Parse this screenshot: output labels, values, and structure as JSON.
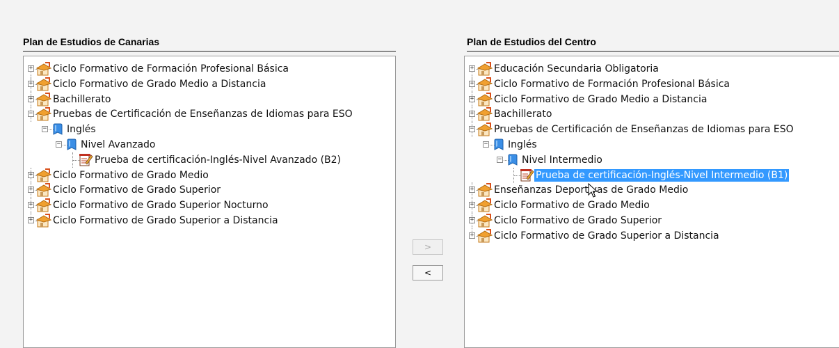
{
  "left_panel": {
    "title": "Plan de Estudios de Canarias",
    "nodes": [
      {
        "label": "Ciclo Formativo de Formación Profesional Básica",
        "expander": "+",
        "icon": "graduation-cap-icon"
      },
      {
        "label": "Ciclo Formativo de Grado Medio a Distancia",
        "expander": "+",
        "icon": "graduation-cap-icon"
      },
      {
        "label": "Bachillerato",
        "expander": "+",
        "icon": "graduation-cap-icon"
      },
      {
        "label": "Pruebas de Certificación de Enseñanzas de Idiomas para ESO",
        "expander": "−",
        "icon": "graduation-cap-icon"
      },
      {
        "label": "Inglés",
        "expander": "−",
        "icon": "bookmark-icon"
      },
      {
        "label": "Nivel Avanzado",
        "expander": "−",
        "icon": "bookmark-icon"
      },
      {
        "label": "Prueba de certificación-Inglés-Nivel Avanzado (B2)",
        "expander": "",
        "icon": "edit-document-icon"
      },
      {
        "label": "Ciclo Formativo de Grado Medio",
        "expander": "+",
        "icon": "graduation-cap-icon"
      },
      {
        "label": "Ciclo Formativo de Grado Superior",
        "expander": "+",
        "icon": "graduation-cap-icon"
      },
      {
        "label": "Ciclo Formativo de Grado Superior Nocturno",
        "expander": "+",
        "icon": "graduation-cap-icon"
      },
      {
        "label": "Ciclo Formativo de Grado Superior a Distancia",
        "expander": "+",
        "icon": "graduation-cap-icon"
      }
    ]
  },
  "right_panel": {
    "title": "Plan de Estudios del Centro",
    "nodes": [
      {
        "label": "Educación Secundaria Obligatoria",
        "expander": "+",
        "icon": "graduation-cap-icon"
      },
      {
        "label": "Ciclo Formativo de Formación Profesional Básica",
        "expander": "+",
        "icon": "graduation-cap-icon"
      },
      {
        "label": "Ciclo Formativo de Grado Medio a Distancia",
        "expander": "+",
        "icon": "graduation-cap-icon"
      },
      {
        "label": "Bachillerato",
        "expander": "+",
        "icon": "graduation-cap-icon"
      },
      {
        "label": "Pruebas de Certificación de Enseñanzas de Idiomas para ESO",
        "expander": "−",
        "icon": "graduation-cap-icon"
      },
      {
        "label": "Inglés",
        "expander": "−",
        "icon": "bookmark-icon"
      },
      {
        "label": "Nivel Intermedio",
        "expander": "−",
        "icon": "bookmark-icon"
      },
      {
        "label": "Prueba de certificación-Inglés-Nivel Intermedio (B1)",
        "expander": "",
        "icon": "edit-document-icon",
        "selected": true
      },
      {
        "label": "Enseñanzas Deportivas de Grado Medio",
        "expander": "+",
        "icon": "graduation-cap-icon"
      },
      {
        "label": "Ciclo Formativo de Grado Medio",
        "expander": "+",
        "icon": "graduation-cap-icon"
      },
      {
        "label": "Ciclo Formativo de Grado Superior",
        "expander": "+",
        "icon": "graduation-cap-icon"
      },
      {
        "label": "Ciclo Formativo de Grado Superior a Distancia",
        "expander": "+",
        "icon": "graduation-cap-icon"
      }
    ]
  },
  "buttons": {
    "add_label": ">",
    "add_enabled": false,
    "remove_label": "<",
    "remove_enabled": true
  },
  "colors": {
    "selection": "#3399ff",
    "cap_orange": "#f0a030",
    "bookmark_blue": "#3a8ee6"
  }
}
